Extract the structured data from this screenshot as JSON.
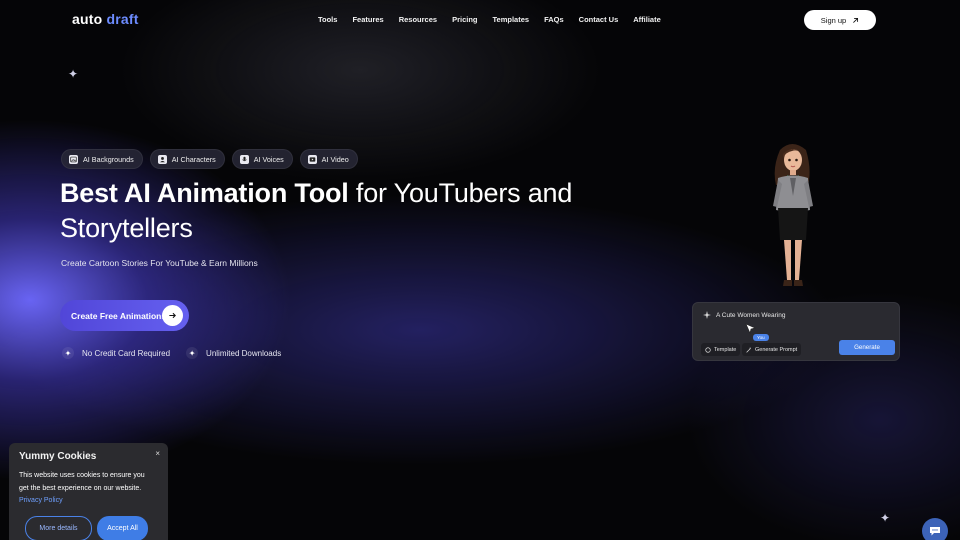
{
  "logo": {
    "part1": "auto",
    "part2": "draft"
  },
  "nav": {
    "items": [
      "Tools",
      "Features",
      "Resources",
      "Pricing",
      "Templates",
      "FAQs",
      "Contact Us",
      "Affiliate"
    ],
    "signup_label": "Sign up",
    "signup_icon": "arrow-up-right-icon"
  },
  "chips": [
    {
      "label": "AI Backgrounds",
      "icon": "image-icon"
    },
    {
      "label": "AI Characters",
      "icon": "character-icon"
    },
    {
      "label": "AI Voices",
      "icon": "voice-icon"
    },
    {
      "label": "AI Video",
      "icon": "video-icon"
    }
  ],
  "hero": {
    "headline_bold": "Best AI Animation Tool",
    "headline_rest": " for YouTubers and Storytellers",
    "subtitle": "Create Cartoon Stories For YouTube & Earn Millions",
    "cta_label": "Create Free Animations",
    "perks": [
      "No Credit Card Required",
      "Unlimited Downloads"
    ]
  },
  "prompt_card": {
    "text": "A Cute Women Wearing",
    "you_tag": "You",
    "template_label": "Template",
    "generate_prompt_label": "Generate Prompt",
    "generate_label": "Generate"
  },
  "cookie": {
    "title": "Yummy Cookies",
    "close": "×",
    "text": "This website uses cookies to ensure you get the best experience on our website.",
    "link": "Privacy Policy",
    "more_label": "More details",
    "accept_label": "Accept All"
  },
  "colors": {
    "accent": "#5146d8",
    "link": "#6fa0ff",
    "button_blue": "#4a82e8",
    "background": "#050507"
  }
}
